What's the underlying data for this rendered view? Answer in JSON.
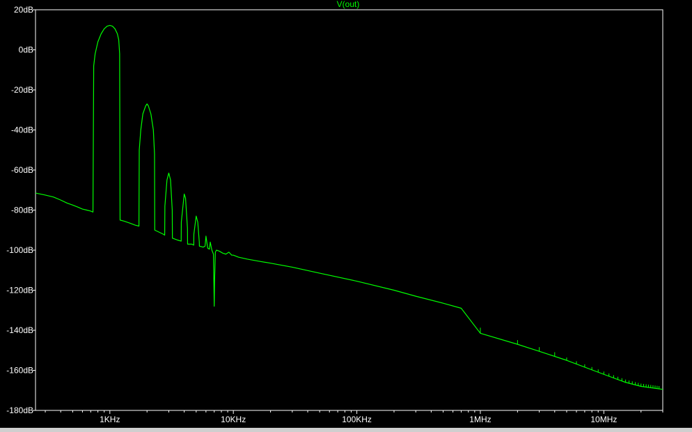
{
  "chart_data": {
    "type": "line",
    "title": "V(out)",
    "xlabel": "",
    "ylabel": "",
    "x_scale": "log",
    "xlim": [
      250,
      30000000
    ],
    "ylim": [
      -180,
      20
    ],
    "grid": false,
    "background": "#000000",
    "axis_color": "#ffffff",
    "x_ticks": [
      {
        "value": 1000,
        "label": "1KHz"
      },
      {
        "value": 10000,
        "label": "10KHz"
      },
      {
        "value": 100000,
        "label": "100KHz"
      },
      {
        "value": 1000000,
        "label": "1MHz"
      },
      {
        "value": 10000000,
        "label": "10MHz"
      }
    ],
    "y_ticks": [
      {
        "value": 20,
        "label": "20dB"
      },
      {
        "value": 0,
        "label": "0dB"
      },
      {
        "value": -20,
        "label": "-20dB"
      },
      {
        "value": -40,
        "label": "-40dB"
      },
      {
        "value": -60,
        "label": "-60dB"
      },
      {
        "value": -80,
        "label": "-80dB"
      },
      {
        "value": -100,
        "label": "-100dB"
      },
      {
        "value": -120,
        "label": "-120dB"
      },
      {
        "value": -140,
        "label": "-140dB"
      },
      {
        "value": -160,
        "label": "-160dB"
      },
      {
        "value": -180,
        "label": "-180dB"
      }
    ],
    "series": [
      {
        "name": "V(out)",
        "color": "#00ff00",
        "points": [
          [
            250,
            -71.5
          ],
          [
            300,
            -72.5
          ],
          [
            350,
            -73.5
          ],
          [
            400,
            -75
          ],
          [
            450,
            -76.5
          ],
          [
            500,
            -77.5
          ],
          [
            550,
            -78.5
          ],
          [
            600,
            -79.5
          ],
          [
            650,
            -80
          ],
          [
            700,
            -80.5
          ],
          [
            730,
            -81
          ],
          [
            740,
            -8
          ],
          [
            760,
            -2
          ],
          [
            800,
            4
          ],
          [
            850,
            8
          ],
          [
            900,
            10.5
          ],
          [
            950,
            11.8
          ],
          [
            1000,
            12.2
          ],
          [
            1050,
            11.8
          ],
          [
            1100,
            10.5
          ],
          [
            1150,
            8
          ],
          [
            1180,
            5
          ],
          [
            1200,
            -2
          ],
          [
            1210,
            -85
          ],
          [
            1300,
            -85.5
          ],
          [
            1450,
            -86.5
          ],
          [
            1600,
            -87.5
          ],
          [
            1720,
            -88
          ],
          [
            1730,
            -50
          ],
          [
            1780,
            -40
          ],
          [
            1850,
            -32
          ],
          [
            1950,
            -28
          ],
          [
            2000,
            -27
          ],
          [
            2050,
            -28
          ],
          [
            2150,
            -32
          ],
          [
            2250,
            -40
          ],
          [
            2300,
            -52
          ],
          [
            2310,
            -90
          ],
          [
            2500,
            -91
          ],
          [
            2700,
            -92
          ],
          [
            2780,
            -92.5
          ],
          [
            2790,
            -78
          ],
          [
            2900,
            -65
          ],
          [
            3000,
            -61.5
          ],
          [
            3100,
            -65
          ],
          [
            3200,
            -80
          ],
          [
            3210,
            -94
          ],
          [
            3550,
            -95
          ],
          [
            3780,
            -95.5
          ],
          [
            3790,
            -86
          ],
          [
            4000,
            -72
          ],
          [
            4100,
            -74
          ],
          [
            4250,
            -89
          ],
          [
            4260,
            -97
          ],
          [
            4600,
            -97
          ],
          [
            4780,
            -97.5
          ],
          [
            4790,
            -92
          ],
          [
            5000,
            -83
          ],
          [
            5150,
            -86
          ],
          [
            5300,
            -96
          ],
          [
            5310,
            -98
          ],
          [
            5700,
            -98.5
          ],
          [
            5900,
            -98
          ],
          [
            6000,
            -93
          ],
          [
            6200,
            -99
          ],
          [
            6400,
            -99.5
          ],
          [
            6500,
            -96
          ],
          [
            6700,
            -100
          ],
          [
            6900,
            -102
          ],
          [
            6950,
            -115
          ],
          [
            7000,
            -128
          ],
          [
            7050,
            -115
          ],
          [
            7150,
            -101
          ],
          [
            7300,
            -100
          ],
          [
            7700,
            -100.5
          ],
          [
            8200,
            -101.5
          ],
          [
            8700,
            -102
          ],
          [
            9200,
            -101
          ],
          [
            9700,
            -102.5
          ],
          [
            10000,
            -102.5
          ],
          [
            11000,
            -103.5
          ],
          [
            13000,
            -104.5
          ],
          [
            16000,
            -105.5
          ],
          [
            20000,
            -106.5
          ],
          [
            30000,
            -108.5
          ],
          [
            50000,
            -111.5
          ],
          [
            100000,
            -115.5
          ],
          [
            200000,
            -120
          ],
          [
            300000,
            -123
          ],
          [
            500000,
            -126.5
          ],
          [
            700000,
            -129
          ],
          [
            1000000,
            -141.5
          ],
          [
            2000000,
            -147
          ],
          [
            3000000,
            -150.5
          ],
          [
            5000000,
            -155
          ],
          [
            10000000,
            -162
          ],
          [
            15000000,
            -166
          ],
          [
            20000000,
            -168
          ],
          [
            30000000,
            -169.5
          ]
        ]
      }
    ],
    "annotations": "small upward spur ticks at harmonics above 1MHz"
  }
}
